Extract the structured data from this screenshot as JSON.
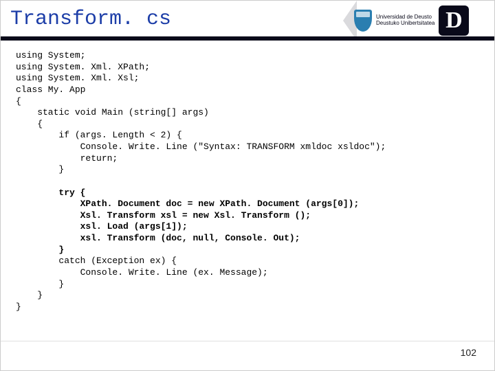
{
  "header": {
    "title": "Transform. cs",
    "logo": {
      "line1": "Universidad de Deusto",
      "line2": "Deustuko Unibertsitatea",
      "letter": "D"
    }
  },
  "code": {
    "l01": "using System;",
    "l02": "using System. Xml. XPath;",
    "l03": "using System. Xml. Xsl;",
    "l04": "class My. App",
    "l05": "{",
    "l06": "    static void Main (string[] args)",
    "l07": "    {",
    "l08": "        if (args. Length < 2) {",
    "l09": "            Console. Write. Line (\"Syntax: TRANSFORM xmldoc xsldoc\");",
    "l10": "            return;",
    "l11": "        }",
    "l12": "",
    "l13": "        try {",
    "l14": "            XPath. Document doc = new XPath. Document (args[0]);",
    "l15": "            Xsl. Transform xsl = new Xsl. Transform ();",
    "l16": "            xsl. Load (args[1]);",
    "l17": "            xsl. Transform (doc, null, Console. Out);",
    "l18": "        }",
    "l19": "        catch (Exception ex) {",
    "l20": "            Console. Write. Line (ex. Message);",
    "l21": "        }",
    "l22": "    }",
    "l23": "}"
  },
  "page_number": "102"
}
